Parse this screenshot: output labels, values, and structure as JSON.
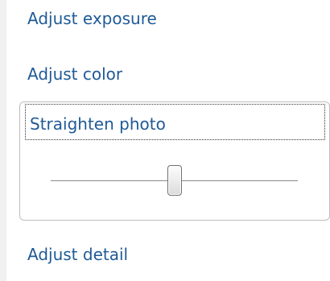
{
  "panel_items": {
    "adjust_exposure": "Adjust exposure",
    "adjust_color": "Adjust color",
    "straighten_photo": "Straighten photo",
    "adjust_detail": "Adjust detail"
  },
  "straighten_slider": {
    "position_percent": 50
  },
  "colors": {
    "link_text": "#1f5a96",
    "panel_border": "#bdbdbd",
    "slider_track": "#8a8a8a"
  }
}
